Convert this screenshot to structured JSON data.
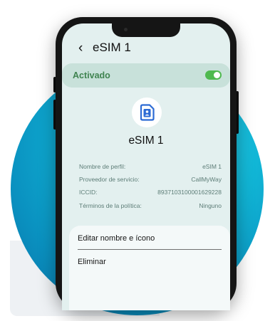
{
  "header": {
    "back_icon": "chevron-left-icon",
    "title": "eSIM 1"
  },
  "status": {
    "label": "Activado",
    "toggle_on": true,
    "accent": "#4fb94f"
  },
  "profile": {
    "icon": "sim-card-contact-icon",
    "name": "eSIM 1"
  },
  "info": [
    {
      "key": "Nombre de perfil:",
      "value": "eSIM 1"
    },
    {
      "key": "Proveedor de servicio:",
      "value": "CallMyWay"
    },
    {
      "key": "ICCID:",
      "value": "8937103100001629228"
    },
    {
      "key": "Términos de la política:",
      "value": "Ninguno"
    }
  ],
  "actions": [
    {
      "label": "Editar nombre e ícono"
    },
    {
      "label": "Eliminar"
    }
  ]
}
